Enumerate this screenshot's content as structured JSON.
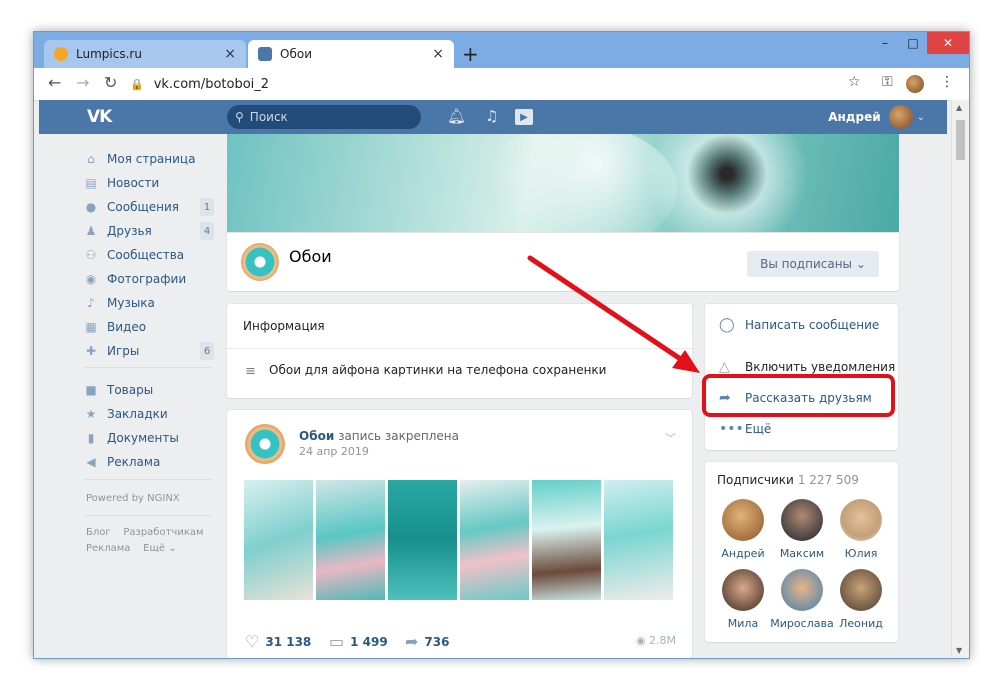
{
  "browser": {
    "tabs": [
      {
        "title": "Lumpics.ru",
        "close": "×"
      },
      {
        "title": "Обои",
        "close": "×"
      }
    ],
    "new_tab": "+",
    "window_buttons": {
      "minimize": "–",
      "maximize": "□",
      "close": "✕"
    },
    "url": "vk.com/botoboi_2"
  },
  "vk_header": {
    "logo": "VK",
    "search_placeholder": "Поиск",
    "user_name": "Андрей"
  },
  "sidebar": {
    "items": [
      {
        "label": "Моя страница",
        "icon": "home-icon",
        "badge": ""
      },
      {
        "label": "Новости",
        "icon": "news-icon",
        "badge": ""
      },
      {
        "label": "Сообщения",
        "icon": "messages-icon",
        "badge": "1"
      },
      {
        "label": "Друзья",
        "icon": "friends-icon",
        "badge": "4"
      },
      {
        "label": "Сообщества",
        "icon": "communities-icon",
        "badge": ""
      },
      {
        "label": "Фотографии",
        "icon": "camera-icon",
        "badge": ""
      },
      {
        "label": "Музыка",
        "icon": "music-icon",
        "badge": ""
      },
      {
        "label": "Видео",
        "icon": "video-icon",
        "badge": ""
      },
      {
        "label": "Игры",
        "icon": "gamepad-icon",
        "badge": "6"
      }
    ],
    "items2": [
      {
        "label": "Товары",
        "icon": "bag-icon"
      },
      {
        "label": "Закладки",
        "icon": "star-icon"
      },
      {
        "label": "Документы",
        "icon": "document-icon"
      },
      {
        "label": "Реклама",
        "icon": "megaphone-icon"
      }
    ],
    "powered": "Powered by NGINX",
    "footer": {
      "blog": "Блог",
      "dev": "Разработчикам",
      "ads": "Реклама",
      "more": "Ещё"
    }
  },
  "group": {
    "name": "Обои",
    "subscribed_button": "Вы подписаны"
  },
  "info": {
    "title": "Информация",
    "description": "Обои для айфона картинки на телефона сохраненки"
  },
  "actions": {
    "send_message": "Написать сообщение",
    "notifications": "Включить уведомления",
    "share": "Рассказать друзьям",
    "more": "Ещё"
  },
  "subscribers": {
    "title": "Подписчики",
    "count": "1 227 509",
    "members": [
      "Андрей",
      "Максим",
      "Юлия",
      "Мила",
      "Мирослава",
      "Леонид"
    ]
  },
  "post": {
    "author": "Обои",
    "pinned": "запись закреплена",
    "date": "24 апр 2019",
    "likes": "31 138",
    "comments": "1 499",
    "shares": "736",
    "views": "2.8M"
  },
  "colors": {
    "vk_blue": "#4a76a8",
    "link": "#2a5885",
    "highlight_red": "#e3101a",
    "browser_chrome": "#7dace4"
  }
}
